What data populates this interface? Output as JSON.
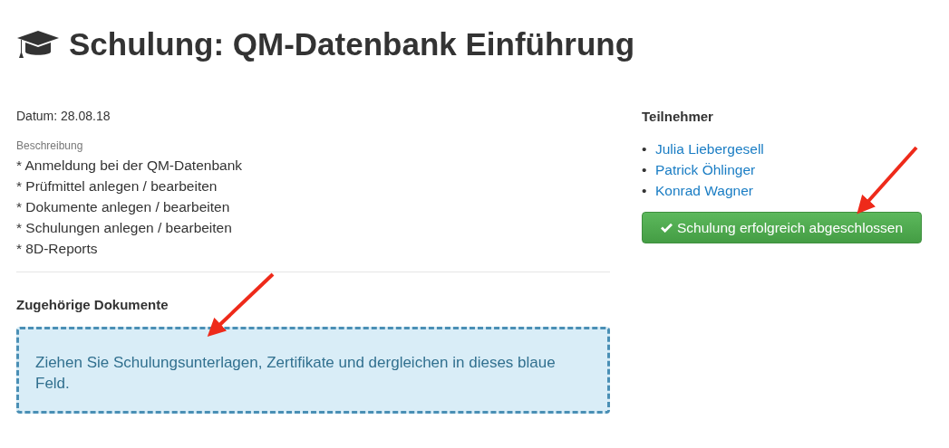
{
  "title": "Schulung: QM-Datenbank Einführung",
  "date": "Datum: 28.08.18",
  "description": {
    "label": "Beschreibung",
    "lines": [
      "* Anmeldung bei der QM-Datenbank",
      "* Prüfmittel anlegen / bearbeiten",
      "* Dokumente anlegen / bearbeiten",
      "* Schulungen anlegen / bearbeiten",
      "* 8D-Reports"
    ]
  },
  "documents": {
    "heading": "Zugehörige Dokumente",
    "dropzone": "Ziehen Sie Schulungsunterlagen, Zertifikate und dergleichen in dieses blaue Feld."
  },
  "participants": {
    "heading": "Teilnehmer",
    "names": [
      {
        "bullet": "•",
        "name": "Julia Liebergesell"
      },
      {
        "bullet": "•",
        "name": "Patrick Öhlinger"
      },
      {
        "bullet": "•",
        "name": "Konrad Wagner"
      }
    ]
  },
  "complete_button": "Schulung erfolgreich abgeschlossen"
}
